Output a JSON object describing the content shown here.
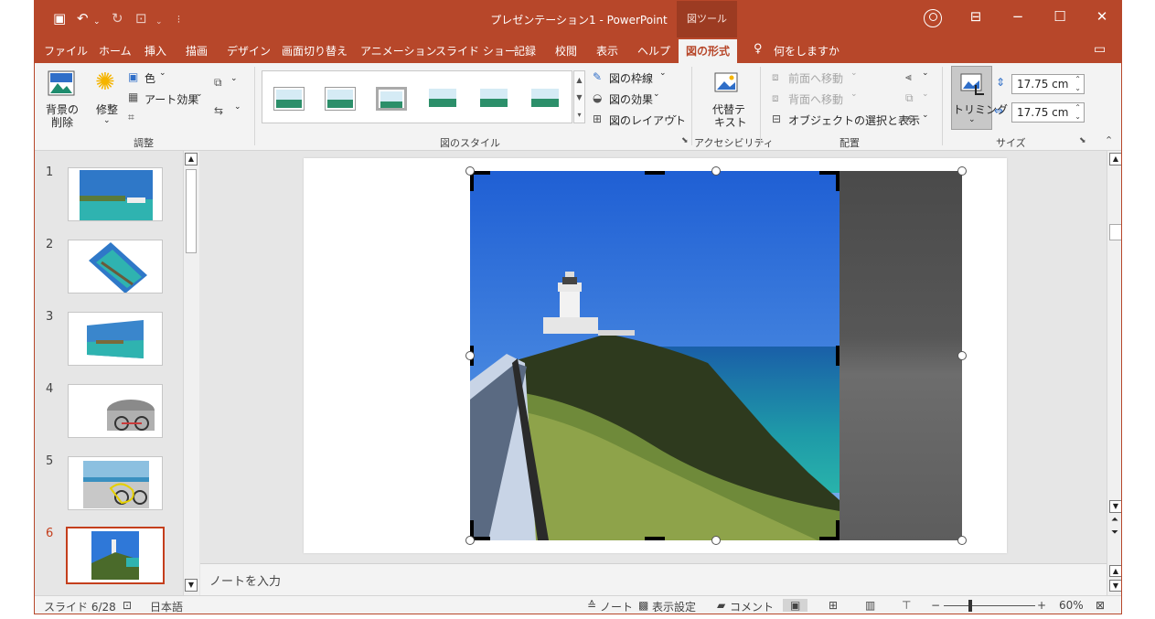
{
  "title_bar": {
    "document_title": "プレゼンテーション1  -  PowerPoint",
    "context_tab_title": "図ツール"
  },
  "tabs": [
    {
      "label": "ファイル"
    },
    {
      "label": "ホーム"
    },
    {
      "label": "挿入"
    },
    {
      "label": "描画"
    },
    {
      "label": "デザイン"
    },
    {
      "label": "画面切り替え"
    },
    {
      "label": "アニメーション"
    },
    {
      "label": "スライド ショー"
    },
    {
      "label": "記録"
    },
    {
      "label": "校閲"
    },
    {
      "label": "表示"
    },
    {
      "label": "ヘルプ"
    },
    {
      "label": "図の形式"
    }
  ],
  "tell_me": "何をしますか",
  "ribbon": {
    "adjust": {
      "remove_background": [
        "背景の",
        "削除"
      ],
      "corrections": "修整",
      "color": "色",
      "artistic_effects": "アート効果",
      "group_label": "調整"
    },
    "styles": {
      "border": "図の枠線",
      "effects": "図の効果",
      "layout": "図のレイアウト",
      "group_label": "図のスタイル"
    },
    "accessibility": {
      "alt_text": [
        "代替テ",
        "キスト"
      ],
      "group_label": "アクセシビリティ"
    },
    "arrange": {
      "bring_forward": "前面へ移動",
      "send_backward": "背面へ移動",
      "selection_pane": "オブジェクトの選択と表示",
      "group_label": "配置"
    },
    "size": {
      "crop": "トリミング",
      "height": "17.75 cm",
      "width": "17.75 cm",
      "group_label": "サイズ"
    }
  },
  "slides": [
    {
      "number": "1"
    },
    {
      "number": "2"
    },
    {
      "number": "3"
    },
    {
      "number": "4"
    },
    {
      "number": "5"
    },
    {
      "number": "6"
    }
  ],
  "notes_placeholder": "ノートを入力",
  "status": {
    "slide_count": "スライド 6/28",
    "language": "日本語",
    "notes": "ノート",
    "display_settings": "表示設定",
    "comments": "コメント",
    "zoom_minus": "−",
    "zoom_plus": "+",
    "zoom": "60%"
  },
  "colors": {
    "accent": "#b7472a",
    "active_slide": "#c43e1c"
  }
}
